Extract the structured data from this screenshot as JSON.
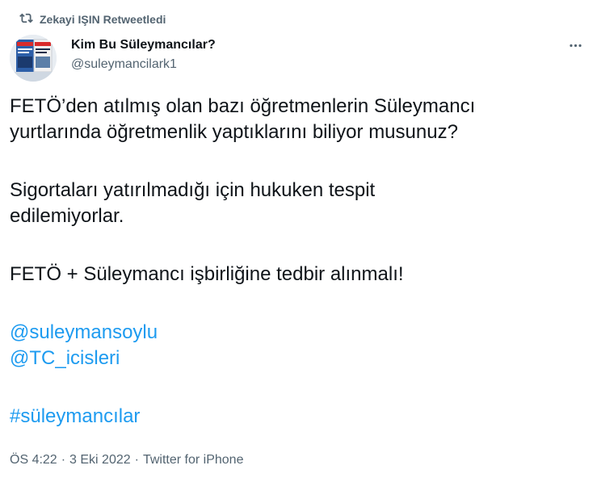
{
  "retweet": {
    "icon": "retweet-icon",
    "label": "Zekayi IŞIN Retweetledi"
  },
  "author": {
    "name": "Kim Bu Süleymancılar?",
    "handle": "@suleymancilark1",
    "avatar_icon": "book-cover-avatar"
  },
  "more_icon": "more-dots-icon",
  "tweet": {
    "line1": "FETÖ’den atılmış olan bazı öğretmenlerin Süleymancı",
    "line2": "yurtlarında öğretmenlik yaptıklarını biliyor musunuz?",
    "line3": "Sigortaları yatırılmadığı için hukuken tespit",
    "line4": "edilemiyorlar.",
    "line5": "FETÖ + Süleymancı işbirliğine tedbir alınmalı!",
    "mention1": "@suleymansoylu",
    "mention2": "@TC_icisleri",
    "hashtag": "#süleymancılar"
  },
  "meta": {
    "time": "ÖS 4:22",
    "separator": "·",
    "date": "3 Eki 2022",
    "source": "Twitter for iPhone"
  },
  "colors": {
    "link": "#1d9bf0",
    "secondary": "#536471",
    "text": "#0f1419"
  }
}
